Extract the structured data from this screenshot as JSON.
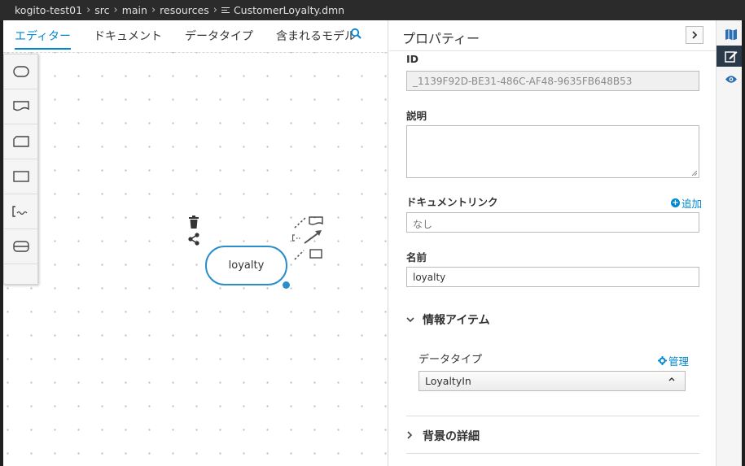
{
  "breadcrumb": {
    "items": [
      "kogito-test01",
      "src",
      "main",
      "resources"
    ],
    "file": "CustomerLoyalty.dmn"
  },
  "editor": {
    "tabs": [
      {
        "label": "エディター",
        "active": true
      },
      {
        "label": "ドキュメント",
        "active": false
      },
      {
        "label": "データタイプ",
        "active": false
      },
      {
        "label": "含まれるモデル",
        "active": false
      }
    ],
    "palette": [
      "decision-icon",
      "input-data-icon",
      "knowledge-source-icon",
      "business-knowledge-model-icon",
      "text-annotation-icon",
      "decision-service-icon"
    ],
    "node": {
      "label": "loyalty"
    }
  },
  "properties": {
    "title": "プロパティー",
    "id_label": "ID",
    "id_value": "_1139F92D-BE31-486C-AF48-9635FB648B53",
    "description_label": "説明",
    "doclink_label": "ドキュメントリンク",
    "doclink_add": "追加",
    "doclink_placeholder": "なし",
    "name_label": "名前",
    "name_value": "loyalty",
    "info_section": "情報アイテム",
    "datatype_label": "データタイプ",
    "datatype_manage": "管理",
    "datatype_value": "LoyaltyIn",
    "bg_section": "背景の詳細"
  },
  "colors": {
    "accent": "#0088ce",
    "node_border": "#2a8ec9",
    "rail_active": "#2b3a4a"
  }
}
